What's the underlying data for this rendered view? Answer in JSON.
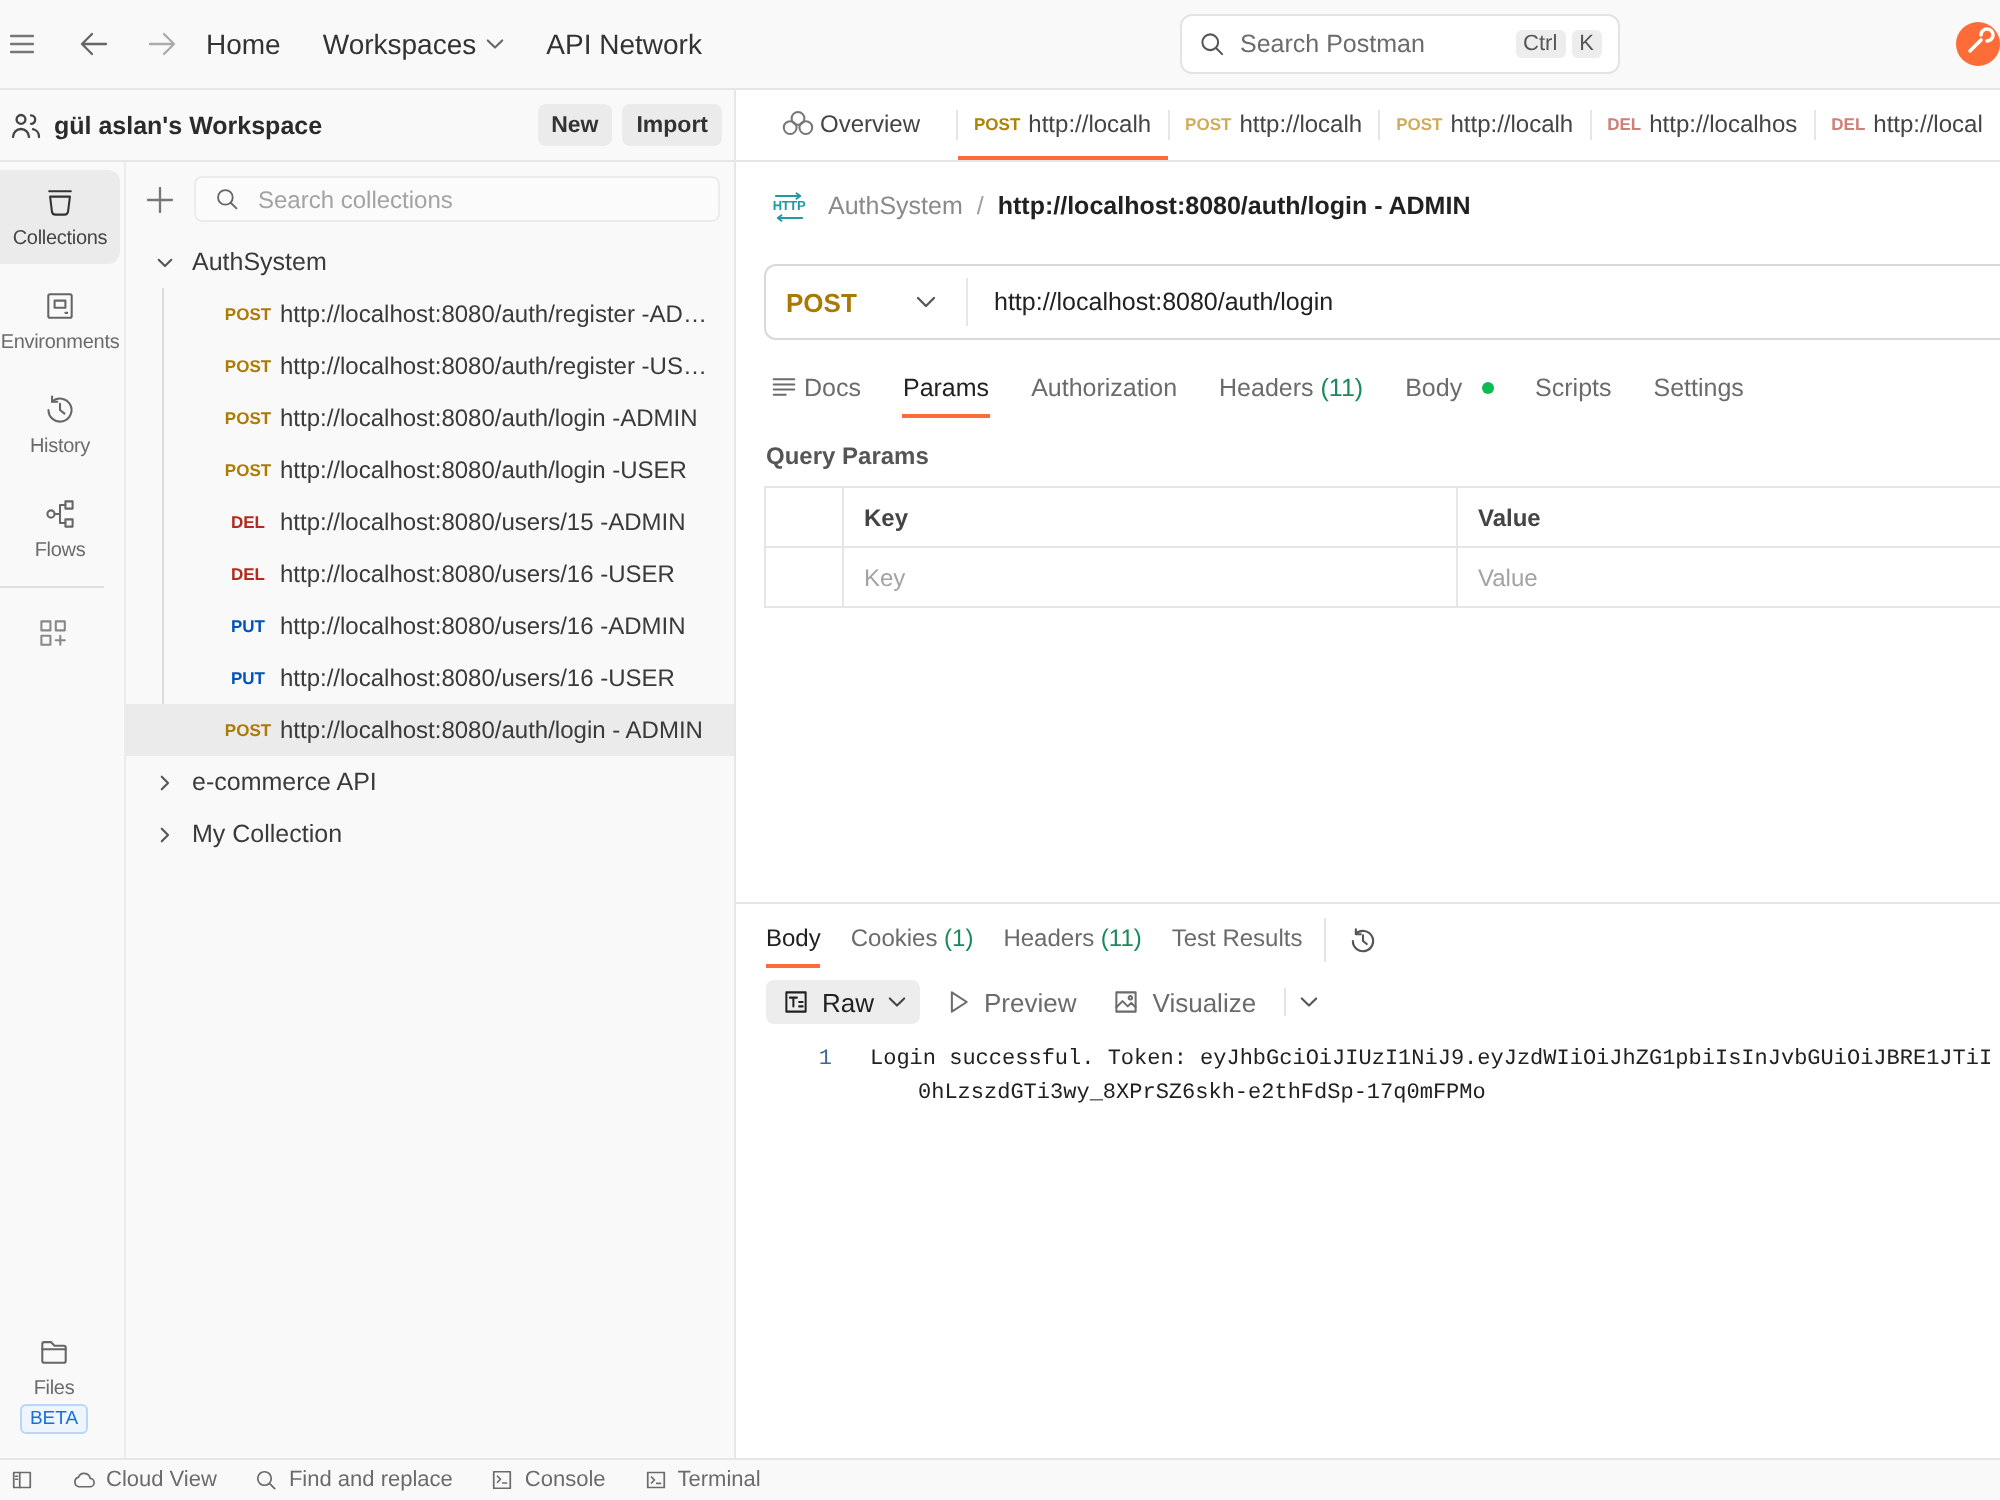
{
  "top_bar": {
    "nav": [
      {
        "label": "Home",
        "dropdown": false
      },
      {
        "label": "Workspaces",
        "dropdown": true
      },
      {
        "label": "API Network",
        "dropdown": false
      }
    ],
    "search": {
      "placeholder": "Search Postman",
      "keys": [
        "Ctrl",
        "K"
      ]
    }
  },
  "sidebar": {
    "workspace": "gül aslan's Workspace",
    "buttons": [
      "New",
      "Import"
    ],
    "rail": [
      {
        "label": "Collections",
        "selected": true
      },
      {
        "label": "Environments",
        "selected": false
      },
      {
        "label": "History",
        "selected": false
      },
      {
        "label": "Flows",
        "selected": false
      }
    ],
    "files": {
      "label": "Files",
      "badge": "BETA"
    },
    "search": {
      "placeholder": "Search collections"
    },
    "collections": [
      {
        "name": "AuthSystem",
        "expanded": true,
        "children": [
          {
            "method": "POST",
            "color": "#ad7a03",
            "name": "http://localhost:8080/auth/register -AD…",
            "selected": false
          },
          {
            "method": "POST",
            "color": "#ad7a03",
            "name": "http://localhost:8080/auth/register -US…",
            "selected": false
          },
          {
            "method": "POST",
            "color": "#ad7a03",
            "name": "http://localhost:8080/auth/login -ADMIN",
            "selected": false
          },
          {
            "method": "POST",
            "color": "#ad7a03",
            "name": "http://localhost:8080/auth/login -USER",
            "selected": false
          },
          {
            "method": "DEL",
            "color": "#b32b1e",
            "name": "http://localhost:8080/users/15 -ADMIN",
            "selected": false
          },
          {
            "method": "DEL",
            "color": "#b32b1e",
            "name": "http://localhost:8080/users/16 -USER",
            "selected": false
          },
          {
            "method": "PUT",
            "color": "#0053b8",
            "name": "http://localhost:8080/users/16 -ADMIN",
            "selected": false
          },
          {
            "method": "PUT",
            "color": "#0053b8",
            "name": "http://localhost:8080/users/16 -USER",
            "selected": false
          },
          {
            "method": "POST",
            "color": "#ad7a03",
            "name": "http://localhost:8080/auth/login - ADMIN",
            "selected": true
          }
        ]
      },
      {
        "name": "e-commerce API",
        "expanded": false
      },
      {
        "name": "My Collection",
        "expanded": false
      }
    ]
  },
  "tabs": [
    {
      "kind": "overview",
      "label": "Overview",
      "selected": false
    },
    {
      "kind": "request",
      "method": "POST",
      "color": "#b08203",
      "label": "http://localh",
      "selected": true
    },
    {
      "kind": "request",
      "method": "POST",
      "color": "#d0ad5a",
      "label": "http://localh",
      "selected": false
    },
    {
      "kind": "request",
      "method": "POST",
      "color": "#d0ad5a",
      "label": "http://localh",
      "selected": false
    },
    {
      "kind": "request",
      "method": "DEL",
      "color": "#cf7f78",
      "label": "http://localhos",
      "selected": false
    },
    {
      "kind": "request",
      "method": "DEL",
      "color": "#cf7f78",
      "label": "http://local",
      "selected": false
    }
  ],
  "request": {
    "breadcrumb": {
      "icon_text": "HTTP",
      "collection": "AuthSystem",
      "separator": "/",
      "title": "http://localhost:8080/auth/login - ADMIN"
    },
    "method": "POST",
    "url": "http://localhost:8080/auth/login",
    "tabs": [
      {
        "label": "Docs",
        "icon": true,
        "dot": false,
        "selected": false
      },
      {
        "label": "Params",
        "icon": false,
        "dot": false,
        "selected": true
      },
      {
        "label": "Authorization",
        "icon": false,
        "dot": false,
        "selected": false
      },
      {
        "label": "Headers",
        "count": "(11)",
        "icon": false,
        "dot": false,
        "selected": false
      },
      {
        "label": "Body",
        "icon": false,
        "dot": true,
        "selected": false
      },
      {
        "label": "Scripts",
        "icon": false,
        "dot": false,
        "selected": false
      },
      {
        "label": "Settings",
        "icon": false,
        "dot": false,
        "selected": false
      }
    ],
    "query_params": {
      "title": "Query Params",
      "columns": [
        "Key",
        "Value"
      ],
      "rows": [
        {
          "key_placeholder": "Key",
          "value_placeholder": "Value"
        }
      ]
    }
  },
  "response": {
    "tabs": [
      {
        "label": "Body",
        "selected": true
      },
      {
        "label": "Cookies",
        "count": "(1)",
        "selected": false
      },
      {
        "label": "Headers",
        "count": "(11)",
        "selected": false
      },
      {
        "label": "Test Results",
        "selected": false
      }
    ],
    "views": [
      {
        "label": "Raw",
        "selected": true,
        "dropdown": true
      },
      {
        "label": "Preview",
        "selected": false,
        "dropdown": false
      },
      {
        "label": "Visualize",
        "selected": false,
        "dropdown": false
      }
    ],
    "lines": [
      {
        "number": "1",
        "text": "Login successful. Token: eyJhbGciOiJIUzI1NiJ9.eyJzdWIiOiJhZG1pbiIsInJvbGUiOiJBRE1JTiI",
        "continuation": "0hLzszdGTi3wy_8XPrSZ6skh-e2thFdSp-17q0mFPMo"
      }
    ]
  },
  "status_bar": {
    "items": [
      "Cloud View",
      "Find and replace",
      "Console",
      "Terminal"
    ]
  }
}
